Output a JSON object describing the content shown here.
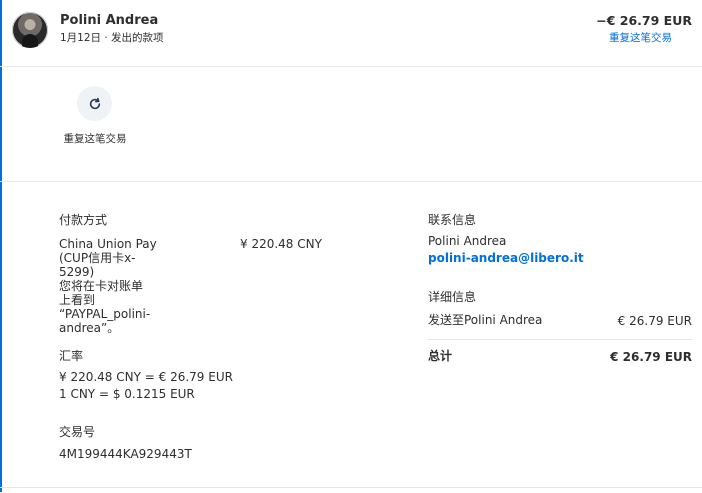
{
  "header": {
    "name": "Polini Andrea",
    "subtitle": "1月12日 · 发出的款项",
    "amount": "−€ 26.79 EUR",
    "repeat_link": "重复这笔交易"
  },
  "action": {
    "repeat_label": "重复这笔交易",
    "icon": "refresh-icon"
  },
  "payment": {
    "heading": "付款方式",
    "method_lines": [
      "China Union Pay",
      "(CUP信用卡x-5299)",
      "您将在卡对账单",
      "上看到",
      "“PAYPAL_polini-",
      "andrea”。"
    ],
    "amount": "¥ 220.48 CNY"
  },
  "exchange": {
    "heading": "汇率",
    "line1": "¥ 220.48 CNY = € 26.79 EUR",
    "line2": "1 CNY = $ 0.1215 EUR"
  },
  "transaction": {
    "heading": "交易号",
    "id": "4M199444KA929443T"
  },
  "contact": {
    "heading": "联系信息",
    "name": "Polini Andrea",
    "email": "polini-andrea@libero.it"
  },
  "details": {
    "heading": "详细信息",
    "sent_to": "发送至Polini Andrea",
    "sent_amount": "€ 26.79 EUR",
    "total_label": "总计",
    "total_amount": "€ 26.79 EUR"
  },
  "colors": {
    "accent": "#0070e0",
    "text": "#2c2e2f",
    "divider": "#e6e6e6"
  }
}
